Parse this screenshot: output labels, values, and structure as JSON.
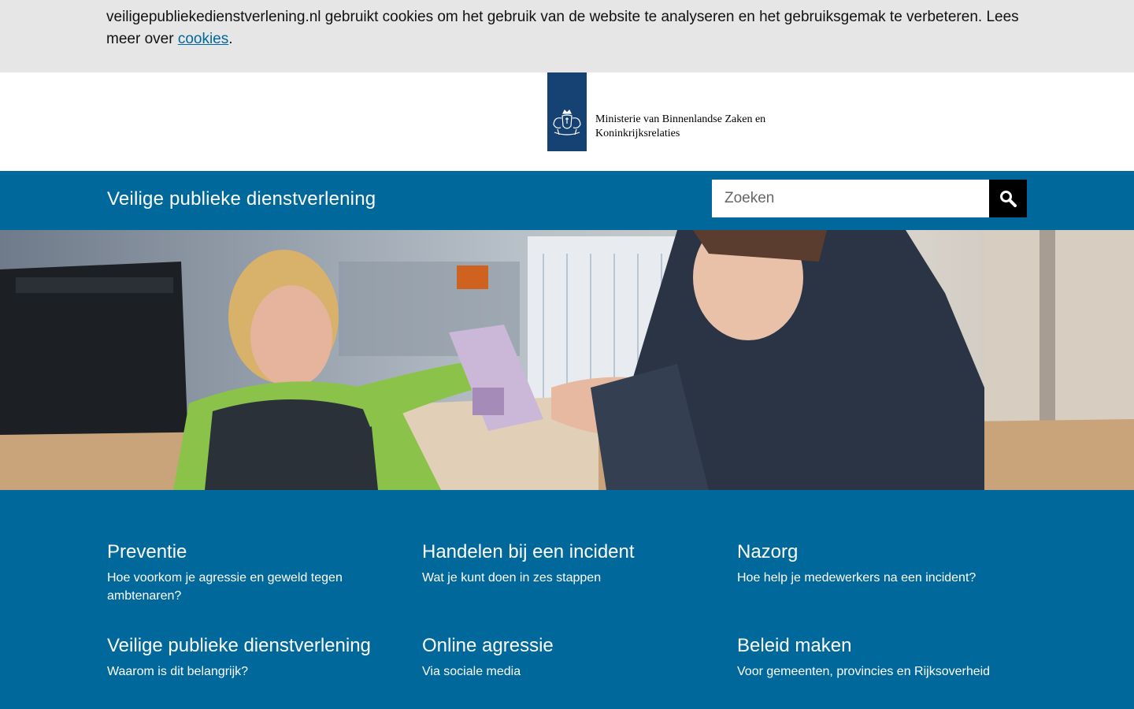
{
  "cookie_banner": {
    "text": "veiligepubliekedienstverlening.nl gebruikt cookies om het gebruik van de website te analyseren en het gebruiksgemak te verbeteren. Lees meer over ",
    "link_label": "cookies",
    "suffix": "."
  },
  "logo": {
    "line1": "Ministerie van Binnenlandse Zaken en",
    "line2": "Koninkrijksrelaties"
  },
  "nav": {
    "site_title": "Veilige publieke dienstverlening",
    "search_placeholder": "Zoeken"
  },
  "topics": [
    {
      "title": "Preventie",
      "subtitle": "Hoe voorkom je agressie en geweld tegen ambtenaren?"
    },
    {
      "title": "Handelen bij een incident",
      "subtitle": "Wat je kunt doen in zes stappen"
    },
    {
      "title": "Nazorg",
      "subtitle": "Hoe help je medewerkers na een incident?"
    },
    {
      "title": "Veilige publieke dienstverlening",
      "subtitle": "Waarom is dit belangrijk?"
    },
    {
      "title": "Online agressie",
      "subtitle": "Via sociale media"
    },
    {
      "title": "Beleid maken",
      "subtitle": "Voor gemeenten, provincies en Rijksoverheid"
    }
  ],
  "icons": {
    "search": "search-icon",
    "emblem": "coat-of-arms-icon"
  },
  "colors": {
    "brand_blue": "#01689b",
    "logo_blue": "#154273",
    "cookie_bg": "#e6e6e6"
  }
}
